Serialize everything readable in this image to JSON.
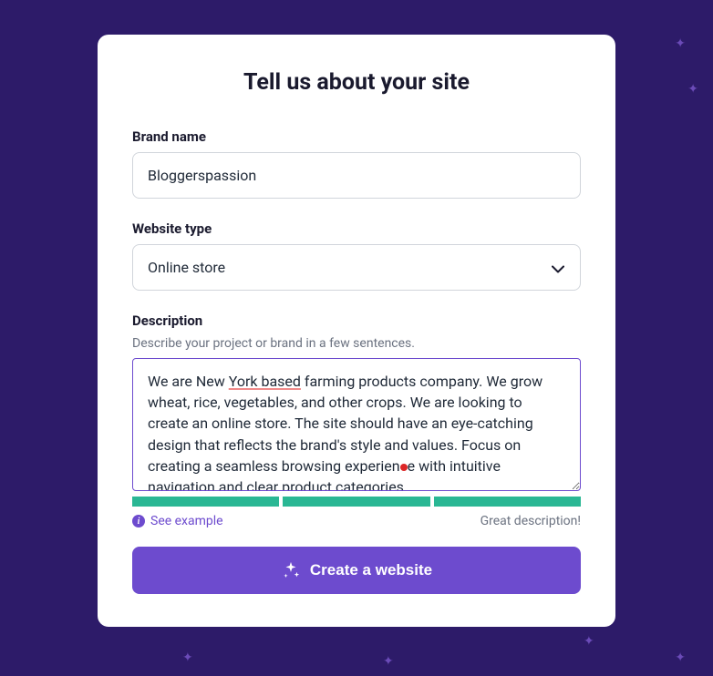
{
  "title": "Tell us about your site",
  "brand_name": {
    "label": "Brand name",
    "value": "Bloggerspassion"
  },
  "website_type": {
    "label": "Website type",
    "value": "Online store"
  },
  "description": {
    "label": "Description",
    "help_text": "Describe your project or brand in a few sentences.",
    "value": "We are New York based farming products company. We grow wheat, rice, vegetables, and other crops. We are looking to create an online store. The site should have an eye-catching design that reflects the brand's style and values. Focus on creating a seamless browsing experience with intuitive navigation and clear product categories.",
    "underlined_text": "York based"
  },
  "feedback": {
    "see_example_label": "See example",
    "quality_text": "Great description!"
  },
  "create_button_label": "Create a website"
}
